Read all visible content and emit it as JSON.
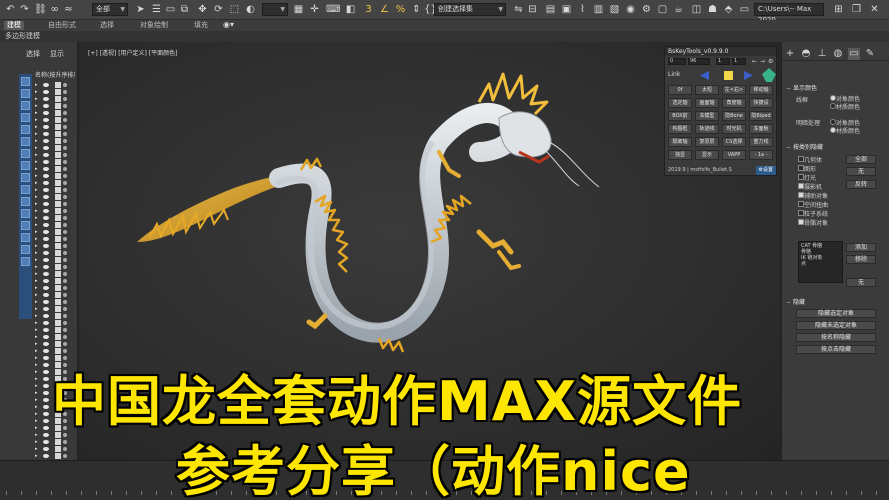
{
  "toolbar": {
    "scope_dropdown": "全部",
    "selection_set_dropdown": "创建选择集",
    "path_field": "C:\\Users\\-- Max 2020",
    "icons": [
      "undo-icon",
      "redo-icon",
      "link-icon",
      "unlink-icon",
      "bind-icon",
      "select-icon",
      "select-by-name-icon",
      "rect-select-icon",
      "window-crossing-icon",
      "move-icon",
      "rotate-icon",
      "scale-icon",
      "placement-icon",
      "view-dropdown-icon",
      "pivot-icon",
      "snap-3d-icon",
      "angle-snap-icon",
      "percent-snap-icon",
      "spinner-snap-icon",
      "mirror-icon",
      "align-icon",
      "layer-icon",
      "graph-icon",
      "material-icon",
      "render-setup-icon",
      "render-frame-icon",
      "render-icon"
    ]
  },
  "ribbon": {
    "tabs": [
      "建模",
      "自由形式",
      "选择",
      "对象绘制",
      "填充"
    ]
  },
  "sub_label": "多边形建模",
  "explorer": {
    "tabs": [
      "选择",
      "显示"
    ],
    "column_header": "名称(按升序排序)"
  },
  "viewport": {
    "label": "[+] [透视] [用户定义] [平面颜色]"
  },
  "bskey": {
    "title": "BsKeyTools_v0.9.9.0",
    "ctrl_values": [
      "0",
      "96",
      "1",
      "1"
    ],
    "link_label": "Link",
    "buttons": [
      [
        "0f",
        "太短",
        "左<右>",
        "移动轴"
      ],
      [
        "选定轴",
        "画面轴",
        "角度轴",
        "快捷设"
      ],
      [
        "BOX前",
        "冻模型",
        "隐Bone",
        "隐Biped"
      ],
      [
        "构图框",
        "轨迹线",
        "时光机",
        "冻面板"
      ],
      [
        "隔离轴",
        "复原层",
        "CS选择",
        "重力线"
      ],
      [
        "独显",
        "显示",
        "VAPP",
        "- 1a -"
      ]
    ],
    "footer_left": "2019.9 | msHoYo_Buliet.S",
    "settings_label": "设置"
  },
  "cmdpanel": {
    "tab_icons": [
      "create-icon",
      "modify-icon",
      "hierarchy-icon",
      "motion-icon",
      "display-icon",
      "utilities-icon"
    ],
    "display_color_section": "显示颜色",
    "wireframe_label": "线框",
    "shaded_label": "明暗处理",
    "radio_object_color": "对象颜色",
    "radio_material_color": "材质颜色",
    "hide_by_category_section": "按类别隐藏",
    "categories": [
      {
        "label": "几何体",
        "checked": false
      },
      {
        "label": "图形",
        "checked": false
      },
      {
        "label": "灯光",
        "checked": false
      },
      {
        "label": "摄影机",
        "checked": true
      },
      {
        "label": "辅助对象",
        "checked": true
      },
      {
        "label": "空间扭曲",
        "checked": false
      },
      {
        "label": "粒子系统",
        "checked": false
      },
      {
        "label": "骨骼对象",
        "checked": true
      }
    ],
    "btn_all": "全部",
    "btn_none": "无",
    "btn_invert": "反转",
    "list_items": [
      "CAT 骨骼",
      "骨骼",
      "IK 链对象",
      "点"
    ],
    "btn_add": "添加",
    "btn_remove": "移除",
    "btn_none2": "无",
    "hide_section": "隐藏",
    "hide_buttons": [
      "隐藏选定对象",
      "隐藏未选定对象",
      "按名称隐藏",
      "按点击隐藏"
    ]
  },
  "caption": {
    "line1": "中国龙全套动作MAX源文件",
    "line2": "参考分享（动作nice"
  }
}
